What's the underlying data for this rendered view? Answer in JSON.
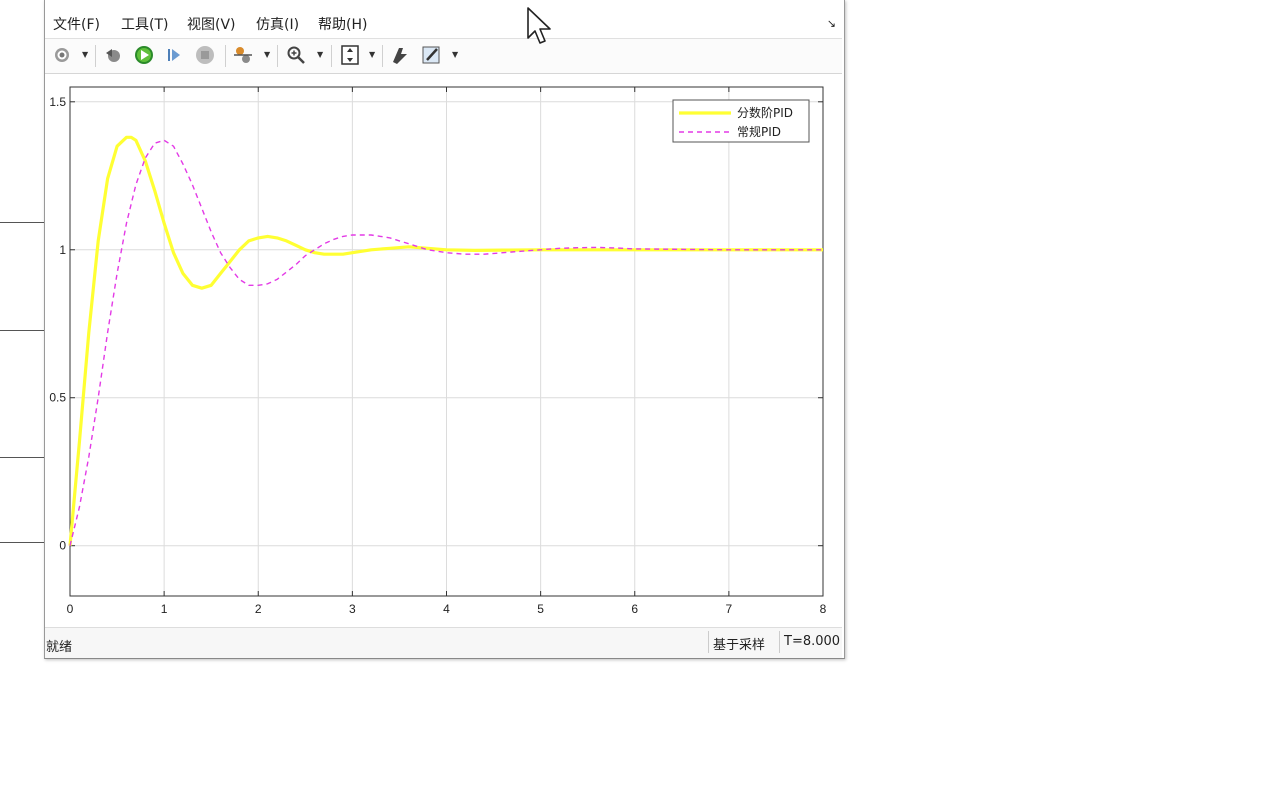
{
  "menu": {
    "file": "文件(F)",
    "tools": "工具(T)",
    "view": "视图(V)",
    "simulation": "仿真(I)",
    "help": "帮助(H)"
  },
  "toolbar": {
    "icons": [
      "gear-icon",
      "step-back-icon",
      "run-icon",
      "step-forward-icon",
      "stop-icon",
      "signal-icon",
      "zoom-icon",
      "fit-icon",
      "highlight-icon",
      "style-icon"
    ]
  },
  "status": {
    "ready": "就绪",
    "mode": "基于采样",
    "time": "T=8.000"
  },
  "colors": {
    "fractional": "#ffff33",
    "conventional": "#e33ae6",
    "grid": "#dcdcdc"
  },
  "chart_data": {
    "type": "line",
    "title": "",
    "xlabel": "",
    "ylabel": "",
    "xlim": [
      0,
      8
    ],
    "ylim": [
      -0.17,
      1.55
    ],
    "xticks": [
      "0",
      "1",
      "2",
      "3",
      "4",
      "5",
      "6",
      "7",
      "8"
    ],
    "yticks": [
      "0",
      "0.5",
      "1",
      "1.5"
    ],
    "grid": true,
    "legend_position": "top-right",
    "series": [
      {
        "name": "分数阶PID",
        "style": "solid",
        "x": [
          0,
          0.1,
          0.2,
          0.3,
          0.4,
          0.5,
          0.6,
          0.65,
          0.7,
          0.8,
          0.9,
          1.0,
          1.1,
          1.2,
          1.3,
          1.4,
          1.5,
          1.6,
          1.7,
          1.8,
          1.9,
          2.0,
          2.1,
          2.2,
          2.3,
          2.4,
          2.5,
          2.6,
          2.7,
          2.8,
          2.9,
          3.0,
          3.2,
          3.4,
          3.6,
          3.8,
          4.0,
          4.3,
          4.6,
          5.0,
          5.5,
          6.0,
          7.0,
          8.0
        ],
        "y": [
          0,
          0.35,
          0.72,
          1.03,
          1.24,
          1.35,
          1.38,
          1.38,
          1.37,
          1.3,
          1.2,
          1.09,
          0.99,
          0.92,
          0.88,
          0.87,
          0.88,
          0.92,
          0.96,
          1.0,
          1.03,
          1.04,
          1.045,
          1.04,
          1.03,
          1.015,
          1.0,
          0.99,
          0.985,
          0.985,
          0.985,
          0.99,
          1.0,
          1.005,
          1.01,
          1.005,
          1.0,
          0.998,
          0.999,
          1.0,
          1.0,
          1.0,
          1.0,
          1.0
        ]
      },
      {
        "name": "常规PID",
        "style": "dashed",
        "x": [
          0,
          0.1,
          0.2,
          0.3,
          0.4,
          0.5,
          0.6,
          0.7,
          0.8,
          0.9,
          1.0,
          1.1,
          1.2,
          1.3,
          1.4,
          1.5,
          1.6,
          1.7,
          1.8,
          1.9,
          2.0,
          2.1,
          2.2,
          2.3,
          2.4,
          2.5,
          2.6,
          2.7,
          2.8,
          2.9,
          3.0,
          3.1,
          3.2,
          3.3,
          3.4,
          3.5,
          3.6,
          3.8,
          4.0,
          4.2,
          4.4,
          4.6,
          4.8,
          5.0,
          5.2,
          5.4,
          5.6,
          5.8,
          6.0,
          7.0,
          8.0
        ],
        "y": [
          0,
          0.13,
          0.3,
          0.5,
          0.72,
          0.92,
          1.09,
          1.22,
          1.31,
          1.36,
          1.37,
          1.35,
          1.29,
          1.22,
          1.14,
          1.06,
          0.99,
          0.94,
          0.9,
          0.88,
          0.88,
          0.885,
          0.9,
          0.925,
          0.95,
          0.98,
          1.0,
          1.02,
          1.035,
          1.045,
          1.05,
          1.05,
          1.05,
          1.045,
          1.04,
          1.03,
          1.02,
          1.0,
          0.99,
          0.985,
          0.985,
          0.99,
          0.995,
          1.0,
          1.005,
          1.007,
          1.008,
          1.006,
          1.003,
          1.0,
          1.0
        ]
      }
    ]
  }
}
